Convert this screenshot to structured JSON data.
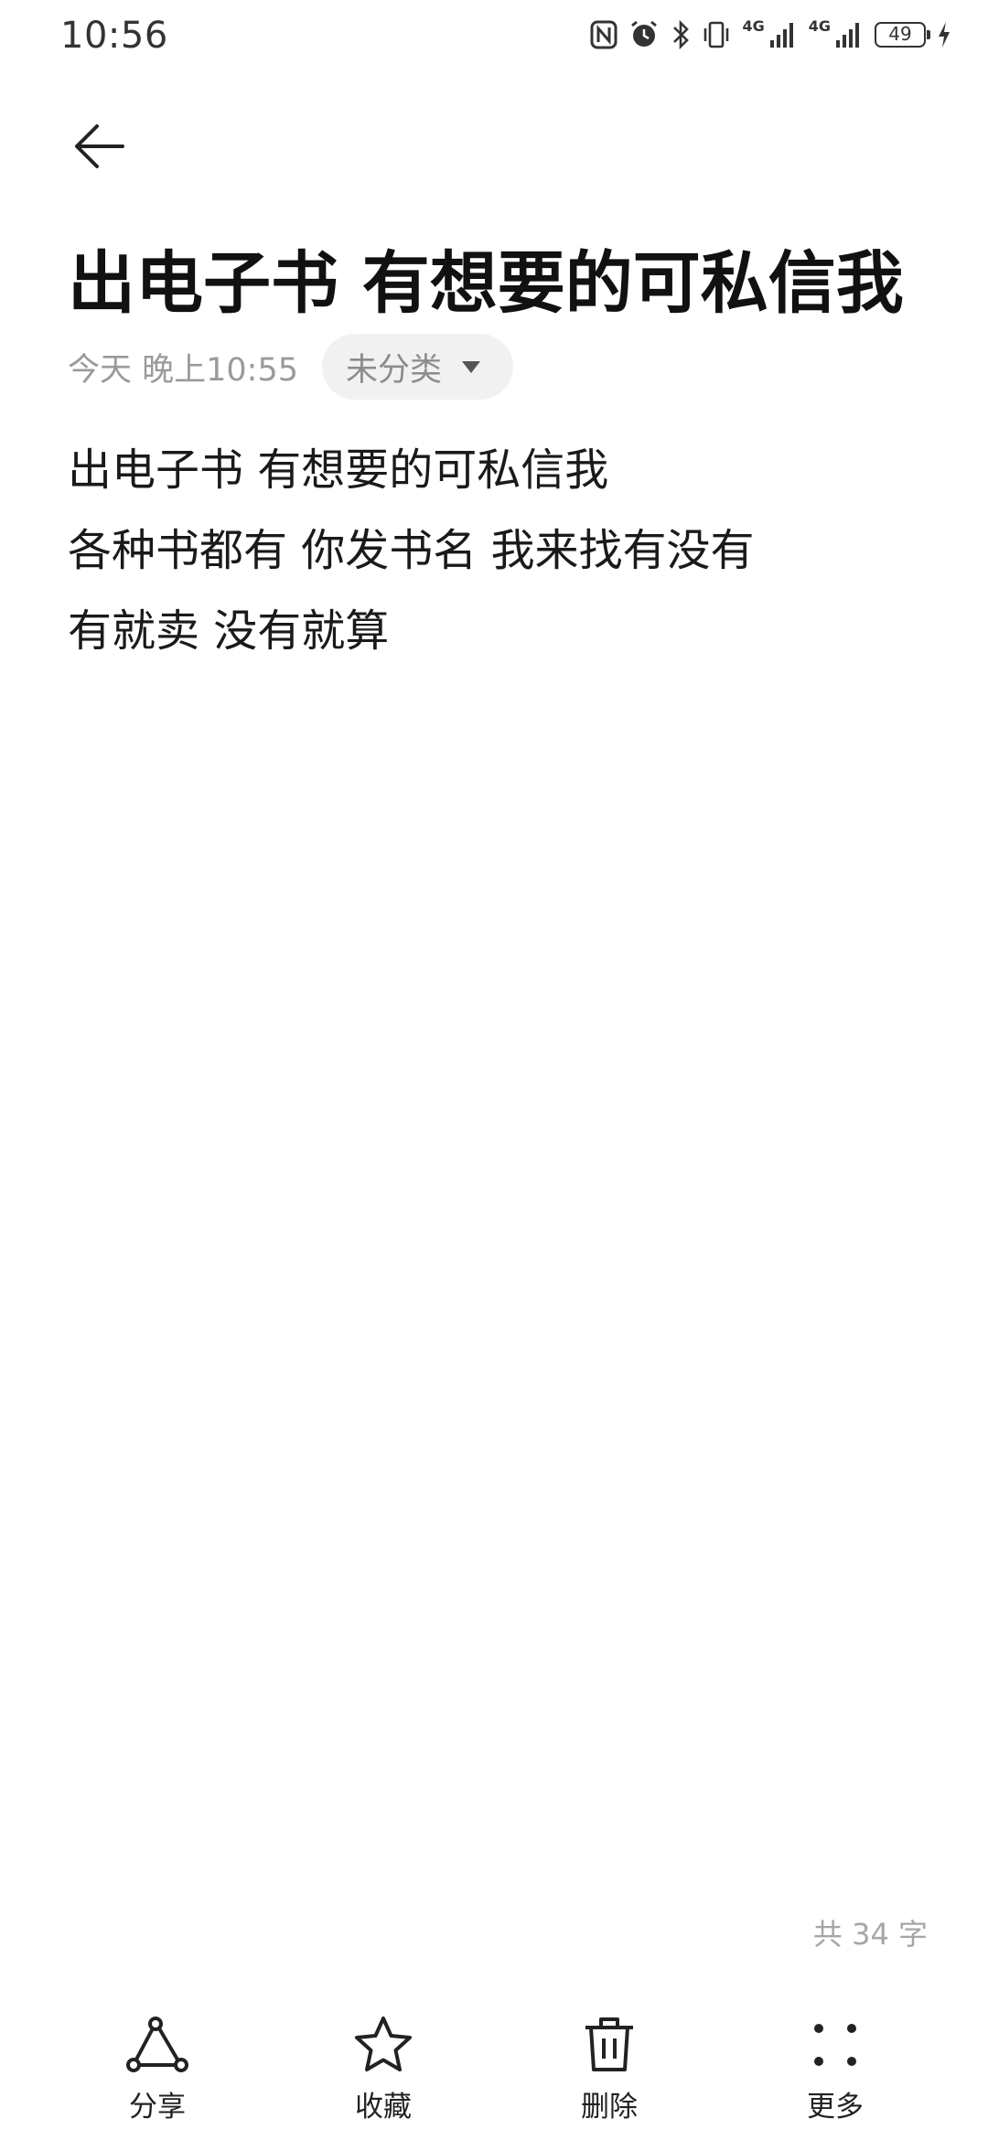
{
  "status_bar": {
    "time": "10:56",
    "network_1": "4G",
    "network_2": "4G",
    "battery": "49",
    "icons": [
      "nfc-icon",
      "alarm-icon",
      "bluetooth-icon",
      "vibrate-icon",
      "signal-icon",
      "signal-icon",
      "battery-icon",
      "charging-icon"
    ]
  },
  "note": {
    "title": "出电子书 有想要的可私信我",
    "date": "今天 晚上10:55",
    "category": "未分类",
    "lines": [
      "出电子书 有想要的可私信我",
      "各种书都有 你发书名 我来找有没有",
      "有就卖 没有就算"
    ],
    "word_count": "共 34 字"
  },
  "toolbar": {
    "share_label": "分享",
    "favorite_label": "收藏",
    "delete_label": "删除",
    "more_label": "更多"
  }
}
